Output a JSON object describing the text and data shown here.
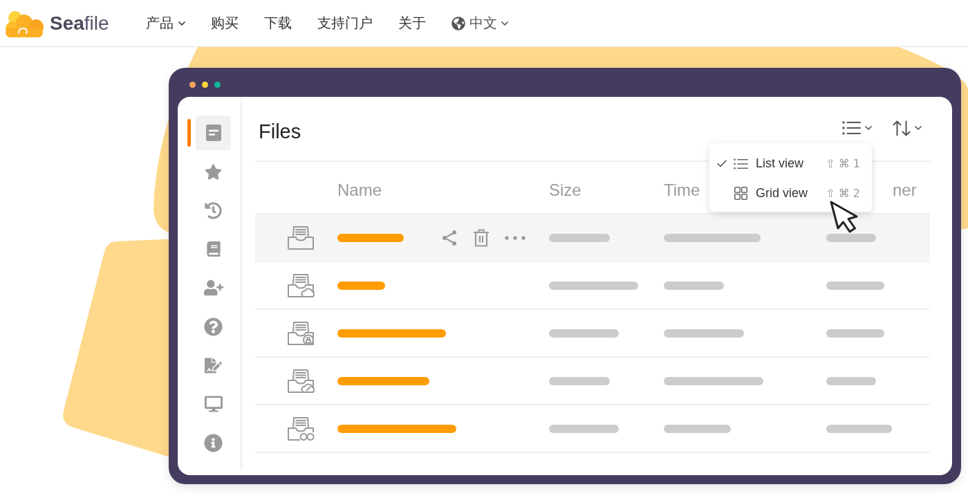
{
  "header": {
    "logo": {
      "text": "**Sea**file"
    },
    "nav": [
      {
        "label": "产品",
        "dropdown": true
      },
      {
        "label": "购买",
        "dropdown": false
      },
      {
        "label": "下载",
        "dropdown": false
      },
      {
        "label": "支持门户",
        "dropdown": false
      },
      {
        "label": "关于",
        "dropdown": false
      }
    ],
    "language": {
      "label": "中文",
      "dropdown": true
    }
  },
  "window": {
    "dots": [
      {
        "color": "#f6a35b"
      },
      {
        "color": "#fcd53a"
      },
      {
        "color": "#10b89a"
      }
    ]
  },
  "sidebar": {
    "items": [
      {
        "kind": "document",
        "selected": true
      },
      {
        "kind": "star",
        "selected": false
      },
      {
        "kind": "history",
        "selected": false
      },
      {
        "kind": "book",
        "selected": false
      },
      {
        "kind": "add-user",
        "selected": false
      },
      {
        "kind": "help",
        "selected": false
      },
      {
        "kind": "signature",
        "selected": false
      },
      {
        "kind": "monitor",
        "selected": false
      },
      {
        "kind": "info",
        "selected": false
      }
    ]
  },
  "files": {
    "title": "Files",
    "toolbar": [
      {
        "kind": "view",
        "expanded": true,
        "menu": [
          {
            "kind": "list",
            "label": "List view",
            "shortcut": "⇧ ⌘ 1",
            "selected": true
          },
          {
            "kind": "grid",
            "label": "Grid view",
            "shortcut": "⇧ ⌘ 2",
            "selected": false
          }
        ]
      },
      {
        "kind": "sort"
      }
    ],
    "columns": [
      "Name",
      "Size",
      "Time",
      "ner"
    ],
    "rows": [
      {
        "kind": "plain",
        "selected": true
      },
      {
        "kind": "cloud",
        "selected": false
      },
      {
        "kind": "lock",
        "selected": false
      },
      {
        "kind": "pencil",
        "selected": false
      },
      {
        "kind": "glasses",
        "selected": false
      }
    ]
  }
}
